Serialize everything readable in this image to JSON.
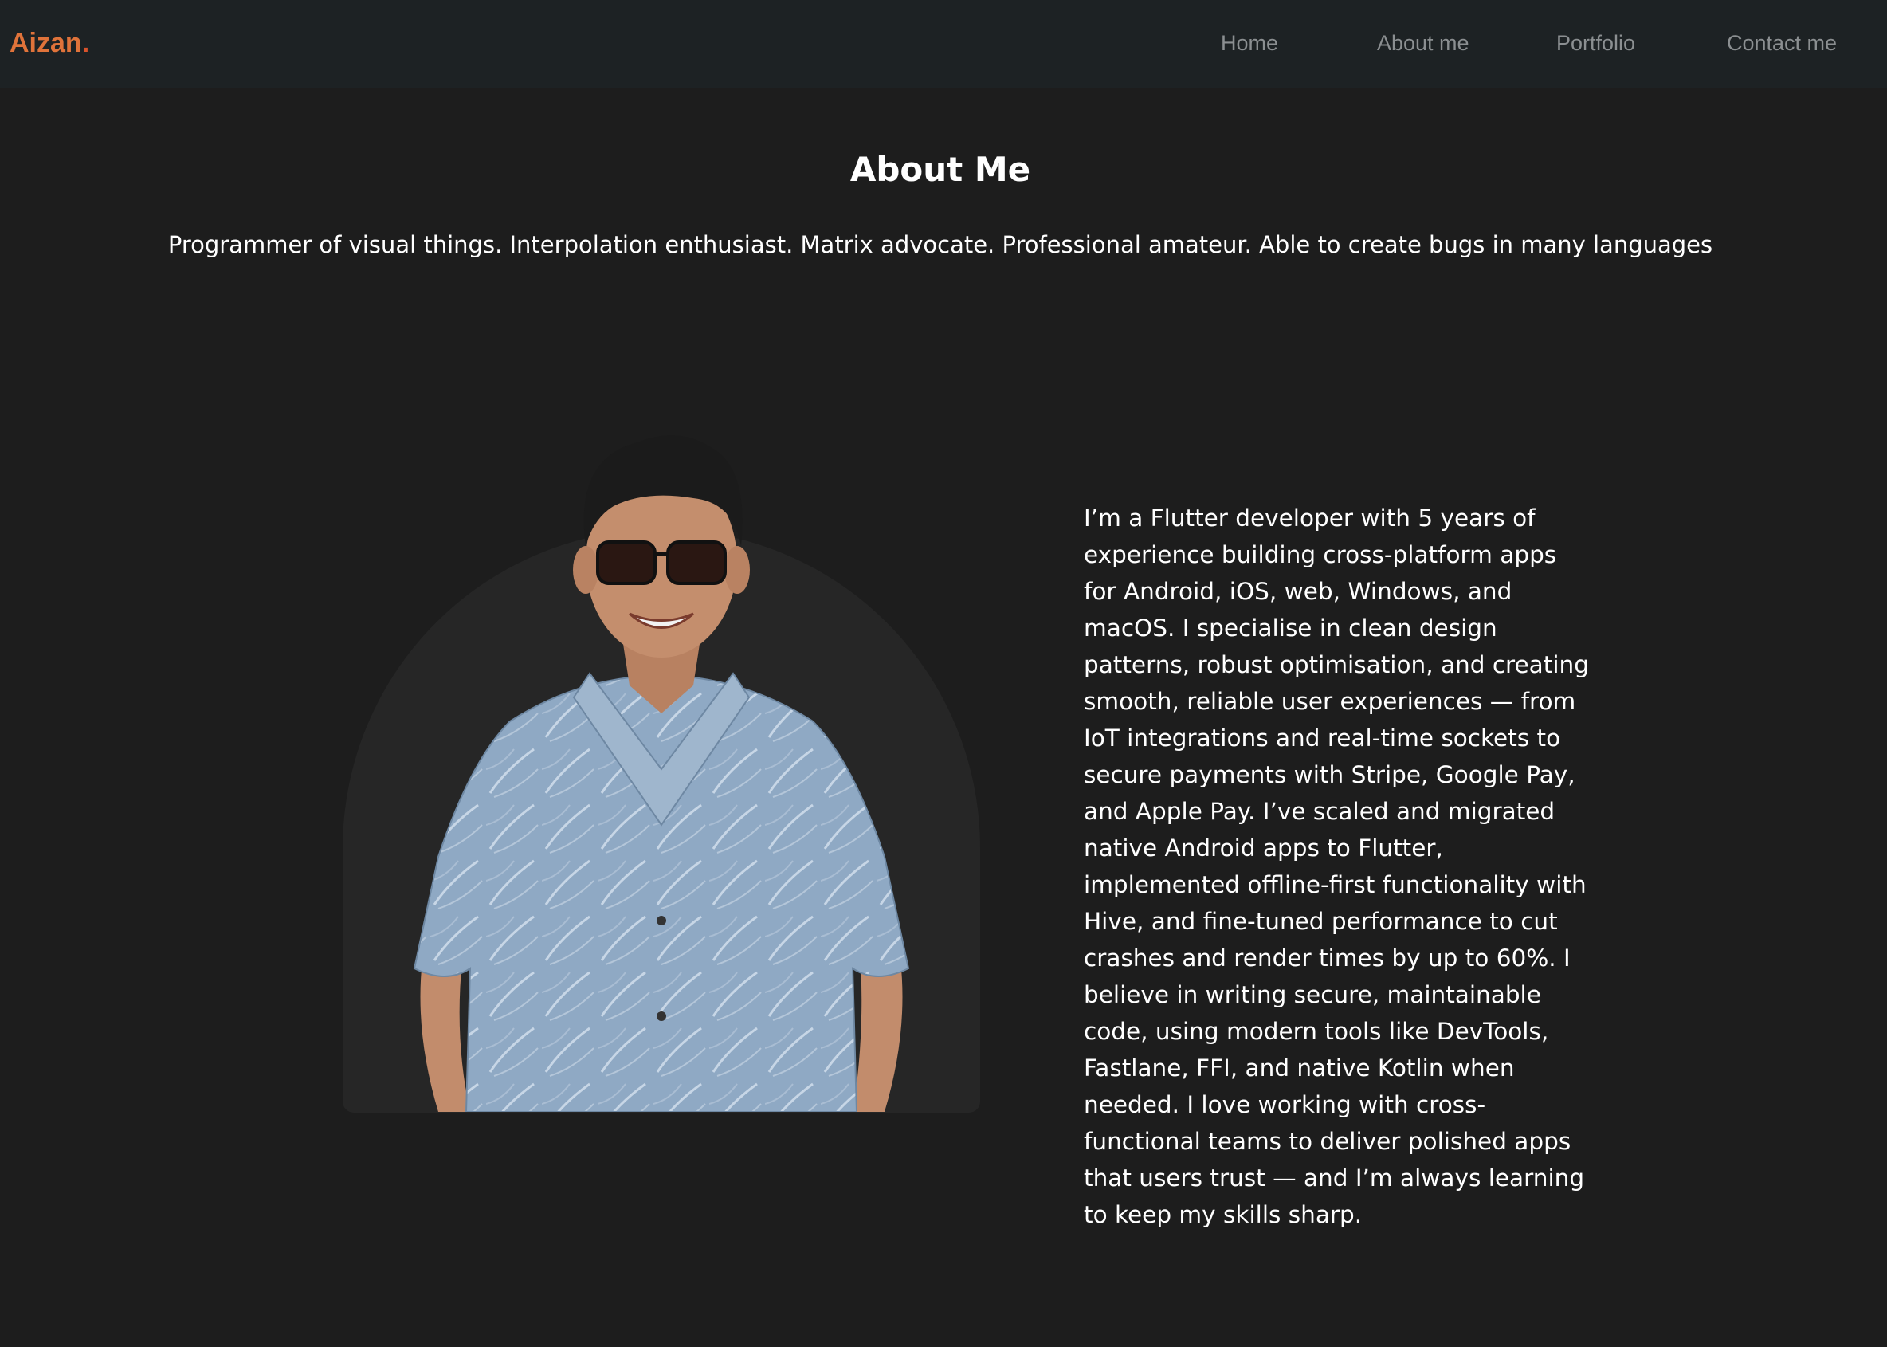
{
  "header": {
    "brand_text": "Aizan",
    "brand_dot": ".",
    "nav": {
      "home": "Home",
      "about": "About me",
      "portfolio": "Portfolio",
      "contact": "Contact me"
    }
  },
  "about": {
    "title": "About Me",
    "tagline": "Programmer of visual things. Interpolation enthusiast. Matrix advocate. Professional amateur. Able to create bugs in many languages",
    "bio": "I’m a Flutter developer with 5 years of experience building cross-platform apps for Android, iOS, web, Windows, and macOS. I specialise in clean design patterns, robust optimisation, and creating smooth, reliable user experiences — from IoT integrations and real-time sockets to secure payments with Stripe, Google Pay, and Apple Pay. I’ve scaled and migrated native Android apps to Flutter, implemented offline-first functionality with Hive, and fine-tuned performance to cut crashes and render times by up to 60%. I believe in writing secure, maintainable code, using modern tools like DevTools, Fastlane, FFI, and native Kotlin when needed. I love working with cross-functional teams to deliver polished apps that users trust — and I’m always learning to keep my skills sharp."
  },
  "colors": {
    "brand": "#e0733a",
    "background": "#1d1d1d",
    "navbar": "#1d2224",
    "nav_text": "#8b8f91",
    "card": "#262626"
  }
}
